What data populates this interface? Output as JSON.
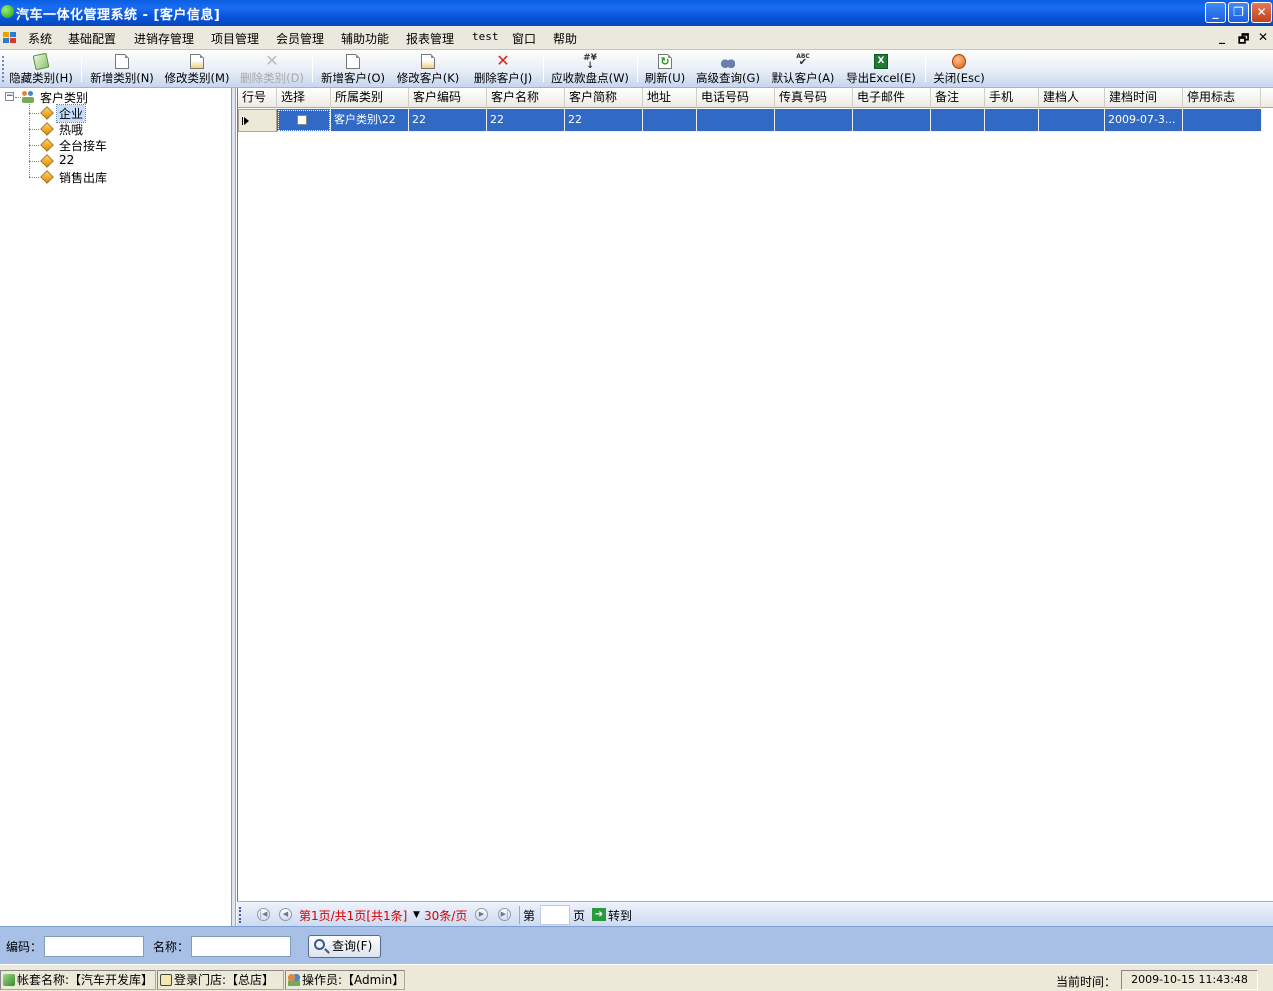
{
  "window": {
    "title": "汽车一体化管理系统 - [客户信息]"
  },
  "menu": [
    "系统",
    "基础配置",
    "进销存管理",
    "项目管理",
    "会员管理",
    "辅助功能",
    "报表管理",
    "test",
    "窗口",
    "帮助"
  ],
  "mdi_controls": [
    "_",
    "🗗",
    "✕"
  ],
  "toolbar": {
    "buttons": [
      {
        "label": "隐藏类别(H)",
        "icon": "hide-icon",
        "enabled": true
      },
      {
        "label": "新增类别(N)",
        "icon": "new-doc-icon",
        "enabled": true
      },
      {
        "label": "修改类别(M)",
        "icon": "edit-doc-icon",
        "enabled": true
      },
      {
        "label": "删除类别(D)",
        "icon": "delete-icon",
        "enabled": false
      },
      {
        "label": "新增客户(O)",
        "icon": "new-doc-icon",
        "enabled": true
      },
      {
        "label": "修改客户(K)",
        "icon": "edit-doc-icon",
        "enabled": true
      },
      {
        "label": "删除客户(J)",
        "icon": "delete-icon",
        "enabled": true
      },
      {
        "label": "应收款盘点(W)",
        "icon": "currency-icon",
        "enabled": true
      },
      {
        "label": "刷新(U)",
        "icon": "refresh-icon",
        "enabled": true
      },
      {
        "label": "高级查询(G)",
        "icon": "binoculars-icon",
        "enabled": true
      },
      {
        "label": "默认客户(A)",
        "icon": "check-abc-icon",
        "enabled": true
      },
      {
        "label": "导出Excel(E)",
        "icon": "excel-icon",
        "enabled": true
      },
      {
        "label": "关闭(Esc)",
        "icon": "close-circle-icon",
        "enabled": true
      }
    ]
  },
  "tree": {
    "root": "客户类别",
    "children": [
      "企业",
      "热哦",
      "全台接车",
      "22",
      "销售出库"
    ],
    "selected_index": 0
  },
  "grid": {
    "columns": [
      "行号",
      "选择",
      "所属类别",
      "客户编码",
      "客户名称",
      "客户简称",
      "地址",
      "电话号码",
      "传真号码",
      "电子邮件",
      "备注",
      "手机",
      "建档人",
      "建档时间",
      "停用标志"
    ],
    "rows": [
      {
        "category": "客户类别\\22",
        "code": "22",
        "name": "22",
        "short": "22",
        "address": "",
        "phone": "",
        "fax": "",
        "email": "",
        "remark": "",
        "mobile": "",
        "creator": "",
        "created": "2009-07-3...",
        "disabled": "",
        "checked": false
      }
    ]
  },
  "pager": {
    "info": "第1页/共1页[共1条]",
    "page_size": "30条/页",
    "page_prefix": "第",
    "page_suffix": "页",
    "goto": "转到",
    "page_input": ""
  },
  "search": {
    "code_label": "编码：",
    "code_value": "",
    "name_label": "名称：",
    "name_value": "",
    "button_label": "查询(F)"
  },
  "status": {
    "account": "帐套名称:【汽车开发库】",
    "store": "登录门店:【总店】",
    "operator": "操作员:【Admin】",
    "time_label": "当前时间：",
    "time_value": "2009-10-15 11:43:48"
  },
  "colors": {
    "title_blue": "#0553d6",
    "selection": "#316ac5",
    "pager_red": "#d40000",
    "search_bg": "#a8c0e6"
  }
}
